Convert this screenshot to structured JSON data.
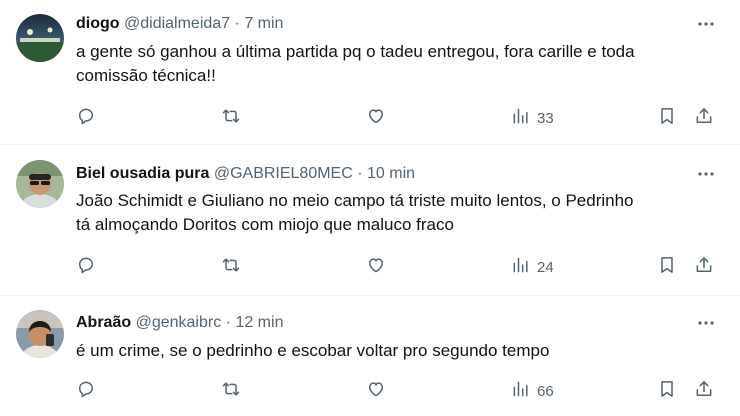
{
  "tweets": [
    {
      "name": "diogo",
      "handle": "@didialmeida7",
      "dot": "·",
      "time": "7 min",
      "lines": [
        "a gente só ganhou a última partida pq o tadeu entregou, fora carille e toda",
        "comissão técnica!!"
      ],
      "views": "33",
      "avatar": "avatar-stadium-night"
    },
    {
      "name": "Biel ousadia pura",
      "handle": "@GABRIEL80MEC",
      "dot": "·",
      "time": "10 min",
      "lines": [
        "João Schimidt e Giuliano no meio campo tá triste muito lentos, o Pedrinho",
        "tá almoçando Doritos com miojo que maluco fraco"
      ],
      "views": "24",
      "avatar": "avatar-man-sunglasses"
    },
    {
      "name": "Abraão",
      "handle": "@genkaibrc",
      "dot": "·",
      "time": "12 min",
      "lines": [
        "é um crime, se o pedrinho e escobar voltar pro segundo tempo"
      ],
      "views": "66",
      "avatar": "avatar-man-photo"
    }
  ],
  "icons": {
    "reply": "reply-icon",
    "retweet": "retweet-icon",
    "like": "like-icon",
    "views": "views-icon",
    "bookmark": "bookmark-icon",
    "share": "share-icon",
    "more": "more-icon"
  },
  "colors": {
    "text": "#0f1419",
    "secondary": "#536471",
    "divider": "#eff3f4"
  }
}
